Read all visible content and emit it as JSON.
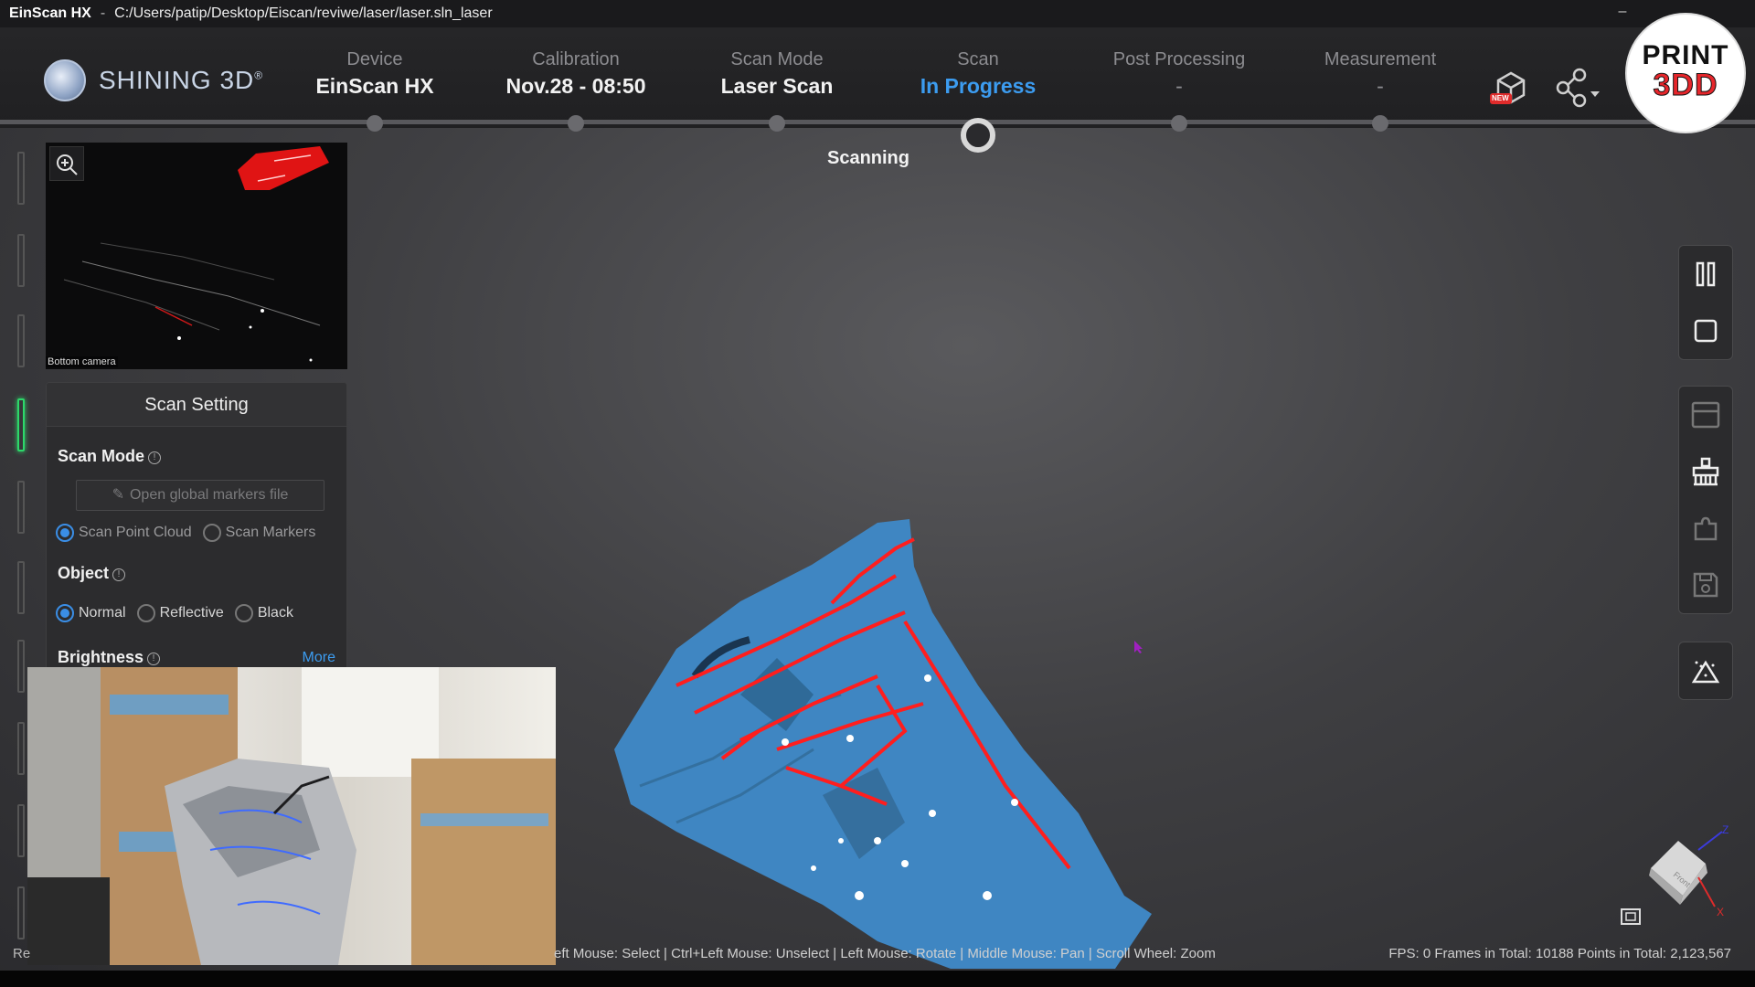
{
  "titlebar": {
    "app_name": "EinScan HX",
    "separator": "-",
    "path": "C:/Users/patip/Desktop/Eiscan/reviwe/laser/laser.sln_laser",
    "minimize": "–"
  },
  "brand": {
    "name": "SHINING 3D",
    "registered": "®"
  },
  "steps": [
    {
      "label": "Device",
      "value": "EinScan HX",
      "state": "done"
    },
    {
      "label": "Calibration",
      "value": "Nov.28 - 08:50",
      "state": "done"
    },
    {
      "label": "Scan Mode",
      "value": "Laser Scan",
      "state": "done"
    },
    {
      "label": "Scan",
      "value": "In Progress",
      "state": "active"
    },
    {
      "label": "Post Processing",
      "value": "-",
      "state": "pending"
    },
    {
      "label": "Measurement",
      "value": "-",
      "state": "pending"
    }
  ],
  "header_icons": {
    "new_badge": "NEW",
    "model_icon": "3d-model-new-icon",
    "share_icon": "share-icon"
  },
  "watermark": {
    "line1": "PRINT",
    "line2": "3DD"
  },
  "viewport": {
    "status": "Scanning"
  },
  "preview": {
    "camera_label": "Bottom camera"
  },
  "scan_setting": {
    "title": "Scan Setting",
    "scan_mode": {
      "heading": "Scan Mode",
      "open_file_label": "Open global markers file",
      "options": [
        "Scan Point Cloud",
        "Scan Markers"
      ],
      "selected": "Scan Point Cloud"
    },
    "object": {
      "heading": "Object",
      "options": [
        "Normal",
        "Reflective",
        "Black"
      ],
      "selected": "Normal"
    },
    "brightness": {
      "heading": "Brightness",
      "more_label": "More"
    }
  },
  "statusbar": {
    "left_cut": "Re",
    "hint": "eft Mouse: Select | Ctrl+Left Mouse: Unselect | Left Mouse: Rotate | Middle Mouse: Pan | Scroll Wheel: Zoom",
    "stats": "FPS:  0   Frames in Total: 10188   Points in Total: 2,123,567"
  },
  "nav_cube": {
    "face": "Front",
    "axis_z": "Z",
    "axis_x": "X"
  },
  "colors": {
    "accent": "#3c9cf0",
    "scan_mesh": "#3f86c2",
    "laser_line": "#ff1e1e",
    "active_rail": "#2dd86a"
  }
}
